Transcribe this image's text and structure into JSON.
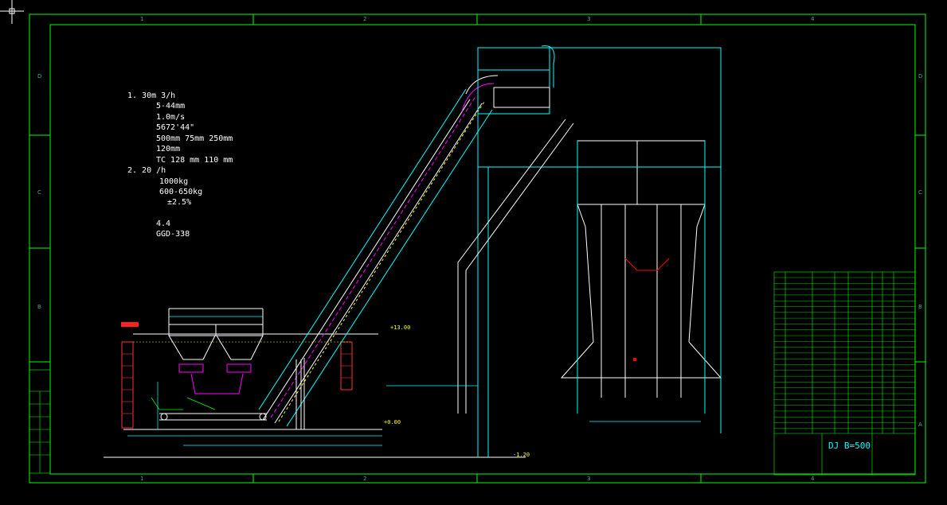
{
  "colors": {
    "background": "#000000",
    "frame": "#00ff00",
    "cyan": "#00ffff",
    "magenta": "#ff00ff",
    "red": "#ff0000",
    "white": "#ffffff",
    "yellow": "#ffff00"
  },
  "frame": {
    "columns": [
      "1",
      "2",
      "3",
      "4"
    ],
    "rows": [
      "D",
      "C",
      "B",
      "A"
    ]
  },
  "notes": {
    "lines": [
      "1.  30m   3/h",
      "5-44mm",
      "1.0m/s",
      "5672'44\"",
      "500mm   75mm   250mm",
      "120mm",
      "TC   128 mm  110 mm",
      "2.  20 /h",
      "1000kg",
      "600-650kg",
      "±2.5%",
      "4.4",
      "GGD-338"
    ]
  },
  "drawing": {
    "title": "DJ B=500",
    "elevations": [
      "+0.00",
      "-1.20",
      "+13.00"
    ]
  }
}
